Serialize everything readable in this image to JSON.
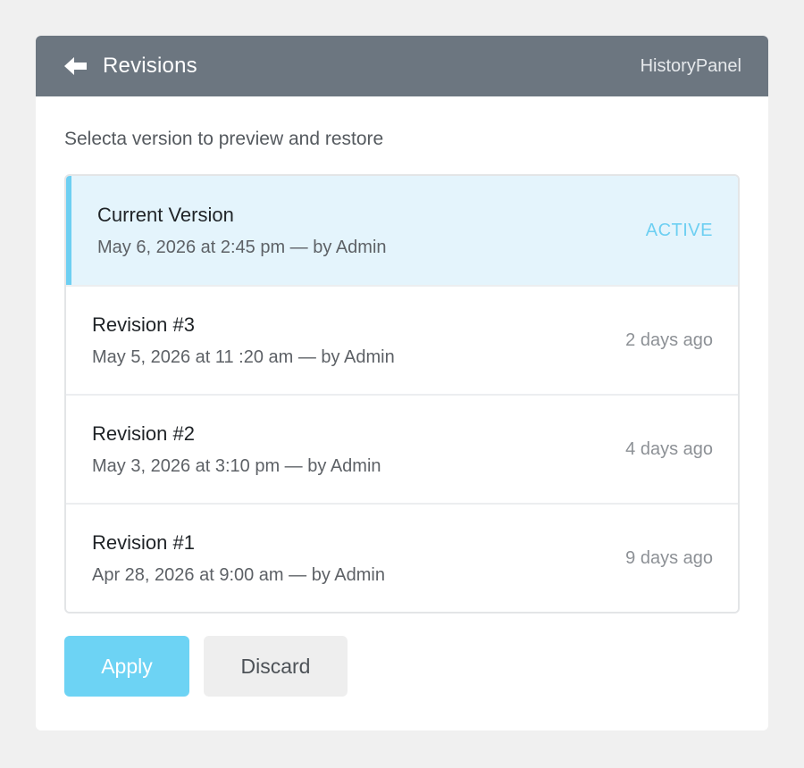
{
  "header": {
    "title": "Revisions",
    "context": "HistoryPanel"
  },
  "instructions": "Selecta version to preview and restore",
  "revisions": [
    {
      "title": "Current Version",
      "meta": "May 6, 2026 at 2:45 pm — by Admin",
      "status": "ACTIVE"
    },
    {
      "title": "Revision #3",
      "meta": "May 5, 2026 at 11 :20 am — by Admin",
      "status": "2 days ago"
    },
    {
      "title": "Revision #2",
      "meta": "May 3, 2026 at 3:10 pm — by Admin",
      "status": "4 days ago"
    },
    {
      "title": "Revision #1",
      "meta": "Apr 28, 2026 at 9:00 am — by Admin",
      "status": "9 days ago"
    }
  ],
  "actions": {
    "apply_label": "Apply",
    "discard_label": "Discard"
  },
  "colors": {
    "header_bg": "#6c7680",
    "accent": "#6dcff2",
    "active_bg": "#e4f4fc"
  },
  "icons": {
    "back": "arrow-left-icon"
  }
}
